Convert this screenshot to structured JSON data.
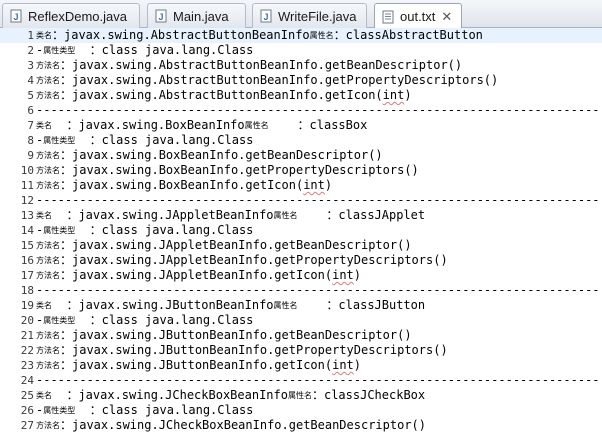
{
  "tabs": [
    {
      "label": "ReflexDemo.java",
      "icon": "java-file-icon",
      "active": false
    },
    {
      "label": "Main.java",
      "icon": "java-file-icon",
      "active": false
    },
    {
      "label": "WriteFile.java",
      "icon": "java-file-icon",
      "active": false
    },
    {
      "label": "out.txt",
      "icon": "text-file-icon",
      "active": true,
      "close": "✕"
    }
  ],
  "editor": {
    "lines": [
      {
        "n": "1",
        "segs": [
          [
            "c",
            "类名"
          ],
          [
            "t",
            "：javax.swing.AbstractButtonBeanInfo"
          ],
          [
            "c",
            "属性名"
          ],
          [
            "t",
            "：classAbstractButton"
          ]
        ]
      },
      {
        "n": "2",
        "segs": [
          [
            "t",
            "-"
          ],
          [
            "c",
            "属性类型"
          ],
          [
            "t",
            "  ：class java.lang.Class"
          ]
        ]
      },
      {
        "n": "3",
        "segs": [
          [
            "c",
            "方法名"
          ],
          [
            "t",
            "：javax.swing.AbstractButtonBeanInfo.getBeanDescriptor()"
          ]
        ]
      },
      {
        "n": "4",
        "segs": [
          [
            "c",
            "方法名"
          ],
          [
            "t",
            "：javax.swing.AbstractButtonBeanInfo.getPropertyDescriptors()"
          ]
        ]
      },
      {
        "n": "5",
        "segs": [
          [
            "c",
            "方法名"
          ],
          [
            "t",
            "：javax.swing.AbstractButtonBeanInfo.getIcon("
          ],
          [
            "s",
            "int"
          ],
          [
            "t",
            ")"
          ]
        ]
      },
      {
        "n": "6",
        "segs": [
          [
            "t",
            "------------------------------------------------------------------------------"
          ]
        ]
      },
      {
        "n": "7",
        "segs": [
          [
            "c",
            "类名"
          ],
          [
            "t",
            "  ：javax.swing.BoxBeanInfo"
          ],
          [
            "c",
            "属性名"
          ],
          [
            "t",
            "    ：classBox"
          ]
        ]
      },
      {
        "n": "8",
        "segs": [
          [
            "t",
            "-"
          ],
          [
            "c",
            "属性类型"
          ],
          [
            "t",
            "  ：class java.lang.Class"
          ]
        ]
      },
      {
        "n": "9",
        "segs": [
          [
            "c",
            "方法名"
          ],
          [
            "t",
            "：javax.swing.BoxBeanInfo.getBeanDescriptor()"
          ]
        ]
      },
      {
        "n": "10",
        "segs": [
          [
            "c",
            "方法名"
          ],
          [
            "t",
            "：javax.swing.BoxBeanInfo.getPropertyDescriptors()"
          ]
        ]
      },
      {
        "n": "11",
        "segs": [
          [
            "c",
            "方法名"
          ],
          [
            "t",
            "：javax.swing.BoxBeanInfo.getIcon("
          ],
          [
            "s",
            "int"
          ],
          [
            "t",
            ")"
          ]
        ]
      },
      {
        "n": "12",
        "segs": [
          [
            "t",
            "------------------------------------------------------------------------------"
          ]
        ]
      },
      {
        "n": "13",
        "segs": [
          [
            "c",
            "类名"
          ],
          [
            "t",
            "  ：javax.swing.JAppletBeanInfo"
          ],
          [
            "c",
            "属性名"
          ],
          [
            "t",
            "    ：classJApplet"
          ]
        ]
      },
      {
        "n": "14",
        "segs": [
          [
            "t",
            "-"
          ],
          [
            "c",
            "属性类型"
          ],
          [
            "t",
            "  ：class java.lang.Class"
          ]
        ]
      },
      {
        "n": "15",
        "segs": [
          [
            "c",
            "方法名"
          ],
          [
            "t",
            "：javax.swing.JAppletBeanInfo.getBeanDescriptor()"
          ]
        ]
      },
      {
        "n": "16",
        "segs": [
          [
            "c",
            "方法名"
          ],
          [
            "t",
            "：javax.swing.JAppletBeanInfo.getPropertyDescriptors()"
          ]
        ]
      },
      {
        "n": "17",
        "segs": [
          [
            "c",
            "方法名"
          ],
          [
            "t",
            "：javax.swing.JAppletBeanInfo.getIcon("
          ],
          [
            "s",
            "int"
          ],
          [
            "t",
            ")"
          ]
        ]
      },
      {
        "n": "18",
        "segs": [
          [
            "t",
            "------------------------------------------------------------------------------"
          ]
        ]
      },
      {
        "n": "19",
        "segs": [
          [
            "c",
            "类名"
          ],
          [
            "t",
            "  ：javax.swing.JButtonBeanInfo"
          ],
          [
            "c",
            "属性名"
          ],
          [
            "t",
            "    ：classJButton"
          ]
        ]
      },
      {
        "n": "20",
        "segs": [
          [
            "t",
            "-"
          ],
          [
            "c",
            "属性类型"
          ],
          [
            "t",
            "  ：class java.lang.Class"
          ]
        ]
      },
      {
        "n": "21",
        "segs": [
          [
            "c",
            "方法名"
          ],
          [
            "t",
            "：javax.swing.JButtonBeanInfo.getBeanDescriptor()"
          ]
        ]
      },
      {
        "n": "22",
        "segs": [
          [
            "c",
            "方法名"
          ],
          [
            "t",
            "：javax.swing.JButtonBeanInfo.getPropertyDescriptors()"
          ]
        ]
      },
      {
        "n": "23",
        "segs": [
          [
            "c",
            "方法名"
          ],
          [
            "t",
            "：javax.swing.JButtonBeanInfo.getIcon("
          ],
          [
            "s",
            "int"
          ],
          [
            "t",
            ")"
          ]
        ]
      },
      {
        "n": "24",
        "segs": [
          [
            "t",
            "------------------------------------------------------------------------------"
          ]
        ]
      },
      {
        "n": "25",
        "segs": [
          [
            "c",
            "类名"
          ],
          [
            "t",
            "  ：javax.swing.JCheckBoxBeanInfo"
          ],
          [
            "c",
            "属性名"
          ],
          [
            "t",
            "：classJCheckBox"
          ]
        ]
      },
      {
        "n": "26",
        "segs": [
          [
            "t",
            "-"
          ],
          [
            "c",
            "属性类型"
          ],
          [
            "t",
            "  ：class java.lang.Class"
          ]
        ]
      },
      {
        "n": "27",
        "segs": [
          [
            "c",
            "方法名"
          ],
          [
            "t",
            "：javax.swing.JCheckBoxBeanInfo.getBeanDescriptor()"
          ]
        ]
      }
    ]
  },
  "colors": {
    "current_line": "#e8f2fe",
    "squiggle": "#e27a7a",
    "java_icon": "#3a6fb0"
  }
}
